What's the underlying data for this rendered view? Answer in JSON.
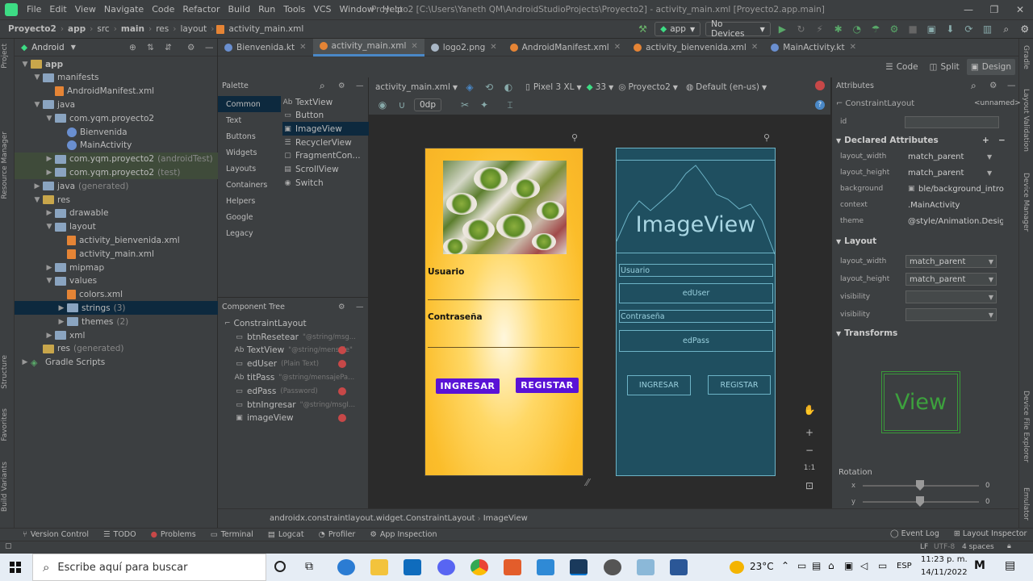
{
  "menubar": {
    "items": [
      "File",
      "Edit",
      "View",
      "Navigate",
      "Code",
      "Refactor",
      "Build",
      "Run",
      "Tools",
      "VCS",
      "Window",
      "Help"
    ],
    "title": "Proyecto2 [C:\\Users\\Yaneth QM\\AndroidStudioProjects\\Proyecto2] - activity_main.xml [Proyecto2.app.main]"
  },
  "navbar": {
    "crumbs": [
      "Proyecto2",
      "app",
      "src",
      "main",
      "res",
      "layout",
      "activity_main.xml"
    ],
    "run_config": "app",
    "devices": "No Devices"
  },
  "left_strip": {
    "labels": [
      "Project",
      "Resource Manager",
      "Structure",
      "Favorites",
      "Build Variants"
    ]
  },
  "right_strip": {
    "labels": [
      "Gradle",
      "Layout Validation",
      "Device Manager",
      "Device File Explorer",
      "Emulator"
    ]
  },
  "project": {
    "view": "Android",
    "tree": [
      {
        "label": "app",
        "level": 0,
        "type": "folder",
        "arrow": "down",
        "bold": true
      },
      {
        "label": "manifests",
        "level": 1,
        "type": "folder",
        "arrow": "down"
      },
      {
        "label": "AndroidManifest.xml",
        "level": 2,
        "type": "xml"
      },
      {
        "label": "java",
        "level": 1,
        "type": "folder",
        "arrow": "down"
      },
      {
        "label": "com.yqm.proyecto2",
        "level": 2,
        "type": "folder",
        "arrow": "down"
      },
      {
        "label": "Bienvenida",
        "level": 3,
        "type": "kt"
      },
      {
        "label": "MainActivity",
        "level": 3,
        "type": "kt"
      },
      {
        "label": "com.yqm.proyecto2",
        "suffix": "(androidTest)",
        "level": 2,
        "type": "folder",
        "arrow": "right",
        "green": true
      },
      {
        "label": "com.yqm.proyecto2",
        "suffix": "(test)",
        "level": 2,
        "type": "folder",
        "arrow": "right",
        "green": true
      },
      {
        "label": "java",
        "suffix": "(generated)",
        "level": 1,
        "type": "folder",
        "arrow": "right"
      },
      {
        "label": "res",
        "level": 1,
        "type": "folder",
        "arrow": "down"
      },
      {
        "label": "drawable",
        "level": 2,
        "type": "folder",
        "arrow": "right"
      },
      {
        "label": "layout",
        "level": 2,
        "type": "folder",
        "arrow": "down"
      },
      {
        "label": "activity_bienvenida.xml",
        "level": 3,
        "type": "xml"
      },
      {
        "label": "activity_main.xml",
        "level": 3,
        "type": "xml"
      },
      {
        "label": "mipmap",
        "level": 2,
        "type": "folder",
        "arrow": "right"
      },
      {
        "label": "values",
        "level": 2,
        "type": "folder",
        "arrow": "down"
      },
      {
        "label": "colors.xml",
        "level": 3,
        "type": "xml"
      },
      {
        "label": "strings",
        "suffix": "(3)",
        "level": 3,
        "type": "folder",
        "arrow": "right",
        "selected": true
      },
      {
        "label": "themes",
        "suffix": "(2)",
        "level": 3,
        "type": "folder",
        "arrow": "right"
      },
      {
        "label": "xml",
        "level": 2,
        "type": "folder",
        "arrow": "right"
      },
      {
        "label": "res",
        "suffix": "(generated)",
        "level": 1,
        "type": "folder",
        "arrow": "none"
      },
      {
        "label": "Gradle Scripts",
        "level": 0,
        "type": "gradle",
        "arrow": "right"
      }
    ]
  },
  "tabs": [
    {
      "label": "Bienvenida.kt",
      "color": "#6a8fd0",
      "active": false
    },
    {
      "label": "activity_main.xml",
      "color": "#e58435",
      "active": true
    },
    {
      "label": "logo2.png",
      "color": "#a9b7c6",
      "active": false
    },
    {
      "label": "AndroidManifest.xml",
      "color": "#e58435",
      "active": false
    },
    {
      "label": "activity_bienvenida.xml",
      "color": "#e58435",
      "active": false
    },
    {
      "label": "MainActivity.kt",
      "color": "#6a8fd0",
      "active": false
    }
  ],
  "design_modes": {
    "code": "Code",
    "split": "Split",
    "design": "Design"
  },
  "palette": {
    "title": "Palette",
    "categories": [
      "Common",
      "Text",
      "Buttons",
      "Widgets",
      "Layouts",
      "Containers",
      "Helpers",
      "Google",
      "Legacy"
    ],
    "items": [
      {
        "icon": "Ab",
        "label": "TextView"
      },
      {
        "icon": "▭",
        "label": "Button"
      },
      {
        "icon": "▣",
        "label": "ImageView",
        "selected": true
      },
      {
        "icon": "☰",
        "label": "RecyclerView"
      },
      {
        "icon": "▢",
        "label": "FragmentCon..."
      },
      {
        "icon": "▤",
        "label": "ScrollView"
      },
      {
        "icon": "◉",
        "label": "Switch"
      }
    ]
  },
  "component_tree": {
    "title": "Component Tree",
    "root": "ConstraintLayout",
    "items": [
      {
        "icon": "▭",
        "label": "btnResetear",
        "hint": "\"@string/msg...",
        "error": false
      },
      {
        "icon": "Ab",
        "label": "TextView",
        "hint": "\"@string/mensaje\"",
        "error": true
      },
      {
        "icon": "▭",
        "label": "edUser",
        "hint": "(Plain Text)",
        "error": true
      },
      {
        "icon": "Ab",
        "label": "titPass",
        "hint": "\"@string/mensajePa...",
        "error": false
      },
      {
        "icon": "▭",
        "label": "edPass",
        "hint": "(Password)",
        "error": true
      },
      {
        "icon": "▭",
        "label": "btnIngresar",
        "hint": "\"@string/msgI...",
        "error": false
      },
      {
        "icon": "▣",
        "label": "imageView",
        "hint": "",
        "error": true
      }
    ]
  },
  "design_toolbar": {
    "file": "activity_main.xml",
    "device": "Pixel 3 XL",
    "api": "33",
    "theme": "Proyecto2",
    "locale": "Default (en-us)",
    "margin": "0dp"
  },
  "phone_preview": {
    "label_user": "Usuario",
    "label_pass": "Contraseña",
    "btn_login": "INGRESAR",
    "btn_register": "REGISTAR"
  },
  "blueprint": {
    "image": "ImageView",
    "user": "Usuario",
    "edUser": "edUser",
    "pass": "Contraseña",
    "edPass": "edPass",
    "btn_login": "INGRESAR",
    "btn_register": "REGISTAR"
  },
  "zoom": {
    "fit": "1:1"
  },
  "attributes": {
    "title": "Attributes",
    "component": "ConstraintLayout",
    "name": "<unnamed>",
    "id_label": "id",
    "declared_title": "Declared Attributes",
    "declared": [
      {
        "name": "layout_width",
        "value": "match_parent",
        "dropdown": true
      },
      {
        "name": "layout_height",
        "value": "match_parent",
        "dropdown": true
      },
      {
        "name": "background",
        "value": "ble/background_intro",
        "dropdown": false
      },
      {
        "name": "context",
        "value": ".MainActivity",
        "dropdown": false
      },
      {
        "name": "theme",
        "value": "@style/Animation.Desigr",
        "dropdown": false
      }
    ],
    "layout_title": "Layout",
    "layout": [
      {
        "name": "layout_width",
        "value": "match_parent"
      },
      {
        "name": "layout_height",
        "value": "match_parent"
      },
      {
        "name": "visibility",
        "value": ""
      },
      {
        "name": "visibility",
        "value": ""
      }
    ],
    "transforms_title": "Transforms",
    "view_label": "View",
    "rotation_label": "Rotation",
    "rot_x": {
      "label": "x",
      "value": "0"
    },
    "rot_y": {
      "label": "y",
      "value": "0"
    }
  },
  "crumbbar": {
    "path": [
      "androidx.constraintlayout.widget.ConstraintLayout",
      "ImageView"
    ]
  },
  "toolwindows": [
    "Version Control",
    "TODO",
    "Problems",
    "Terminal",
    "Logcat",
    "Profiler",
    "App Inspection"
  ],
  "toolwindows_right": [
    "Event Log",
    "Layout Inspector"
  ],
  "status": {
    "lf": "LF",
    "enc": "UTF-8",
    "indent": "4 spaces"
  },
  "taskbar": {
    "search_placeholder": "Escribe aquí para buscar",
    "temp": "23°C",
    "lang": "ESP",
    "time": "11:23 p. m.",
    "date": "14/11/2022"
  }
}
